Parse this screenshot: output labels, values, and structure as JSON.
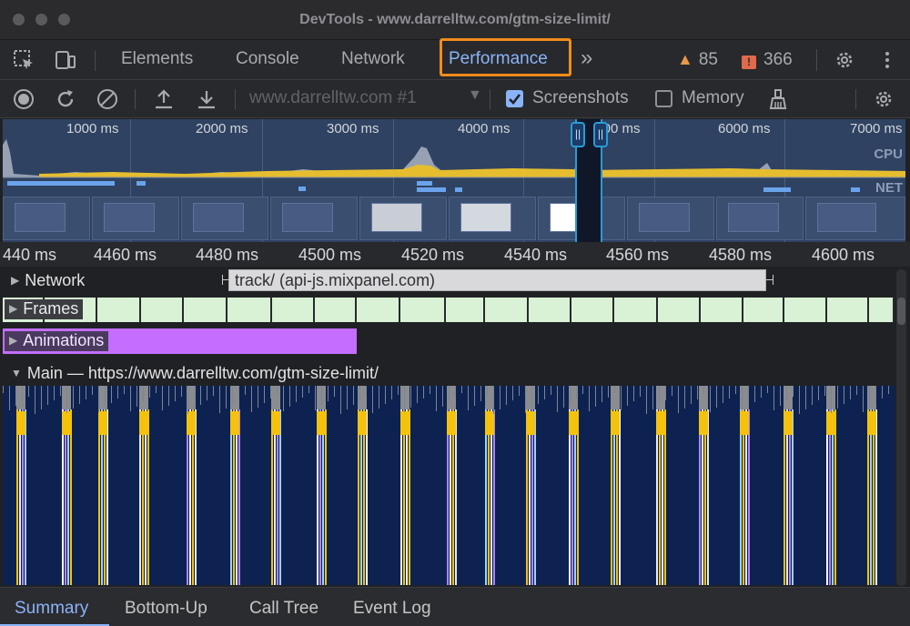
{
  "window": {
    "title": "DevTools - www.darrelltw.com/gtm-size-limit/"
  },
  "tabs": {
    "elements": "Elements",
    "console": "Console",
    "network": "Network",
    "performance": "Performance",
    "more": "»",
    "warnings": "85",
    "errors": "366"
  },
  "toolbar": {
    "recording_select": "www.darrelltw.com #1",
    "screenshots_label": "Screenshots",
    "screenshots_checked": true,
    "memory_label": "Memory",
    "memory_checked": false
  },
  "overview": {
    "ticks": [
      "1000 ms",
      "2000 ms",
      "3000 ms",
      "4000 ms",
      "5000 ms",
      "6000 ms",
      "7000 ms"
    ],
    "cpu_label": "CPU",
    "net_label": "NET"
  },
  "ruler": {
    "ticks": [
      "440 ms",
      "4460 ms",
      "4480 ms",
      "4500 ms",
      "4520 ms",
      "4540 ms",
      "4560 ms",
      "4580 ms",
      "4600 ms"
    ]
  },
  "tracks": {
    "network_label": "Network",
    "network_request": "track/ (api-js.mixpanel.com)",
    "frames_label": "Frames",
    "animations_label": "Animations",
    "main_label": "Main — https://www.darrelltw.com/gtm-size-limit/"
  },
  "bottom_tabs": [
    "Summary",
    "Bottom-Up",
    "Call Tree",
    "Event Log"
  ],
  "colors": {
    "accent": "#8ab4f8",
    "active_outline": "#f28c1b",
    "frames": "#d9f2d6",
    "animations": "#c36eff",
    "scripting": "#f4c20d",
    "rendering": "#b084f5",
    "flame_bg": "#0d2250"
  }
}
